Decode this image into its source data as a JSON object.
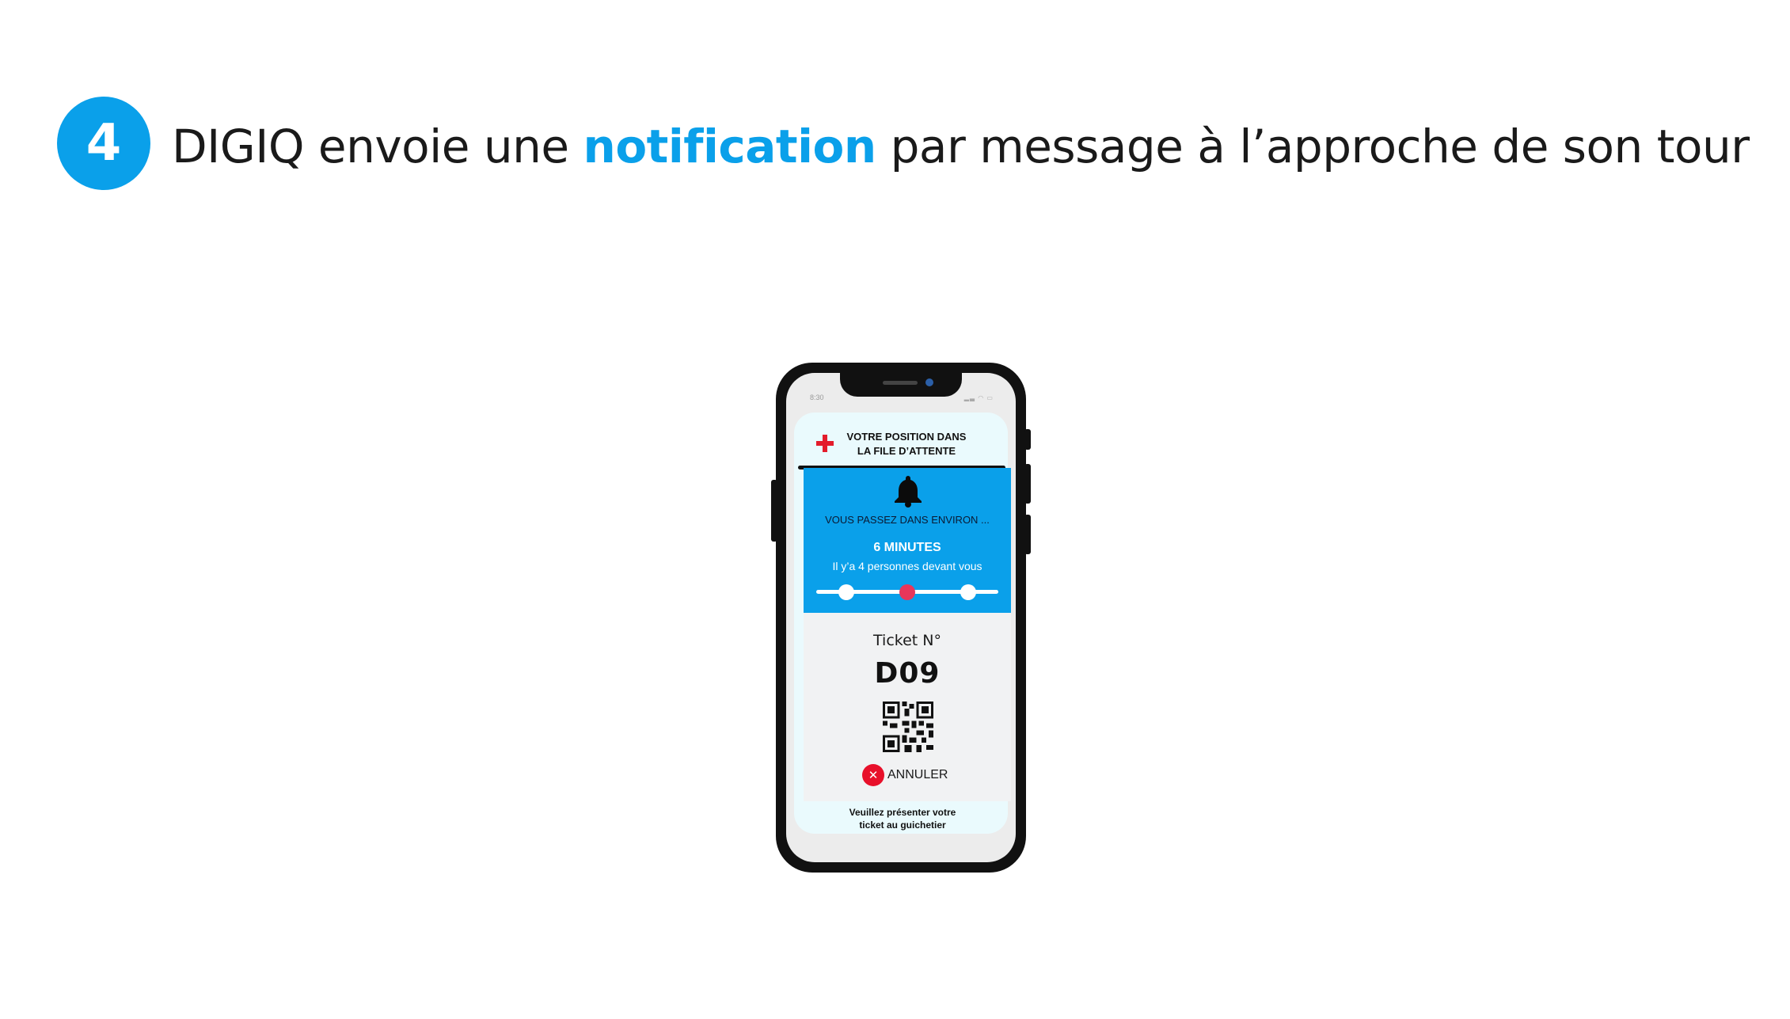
{
  "heading": {
    "step_number": "4",
    "text_before": "DIGIQ envoie une ",
    "highlight": "notification",
    "text_after": " par message à l’approche de son tour",
    "accent_color": "#0aa0ea"
  },
  "phone": {
    "status": {
      "time": "8:30",
      "icons": "signal-wifi-battery"
    },
    "app": {
      "logo_icon": "red-cross-icon",
      "title_line1": "VOTRE POSITION DANS",
      "title_line2": "LA FILE D’ATTENTE",
      "notification": {
        "icon": "bell-icon",
        "line1": "VOUS PASSEZ  DANS ENVIRON ...",
        "minutes": "6 MINUTES",
        "people": "Il y’a 4 personnes devant vous",
        "progress_steps": 3,
        "progress_current_step": 2,
        "background_color": "#0aa0ea",
        "current_step_color": "#e8365a"
      },
      "ticket": {
        "label": "Ticket N°",
        "number": "D09",
        "qr_icon": "qr-code-icon",
        "cancel_label": "ANNULER",
        "cancel_color": "#e8102a"
      },
      "footer_line1": "Veuillez présenter votre",
      "footer_line2": "ticket au guichetier"
    }
  }
}
